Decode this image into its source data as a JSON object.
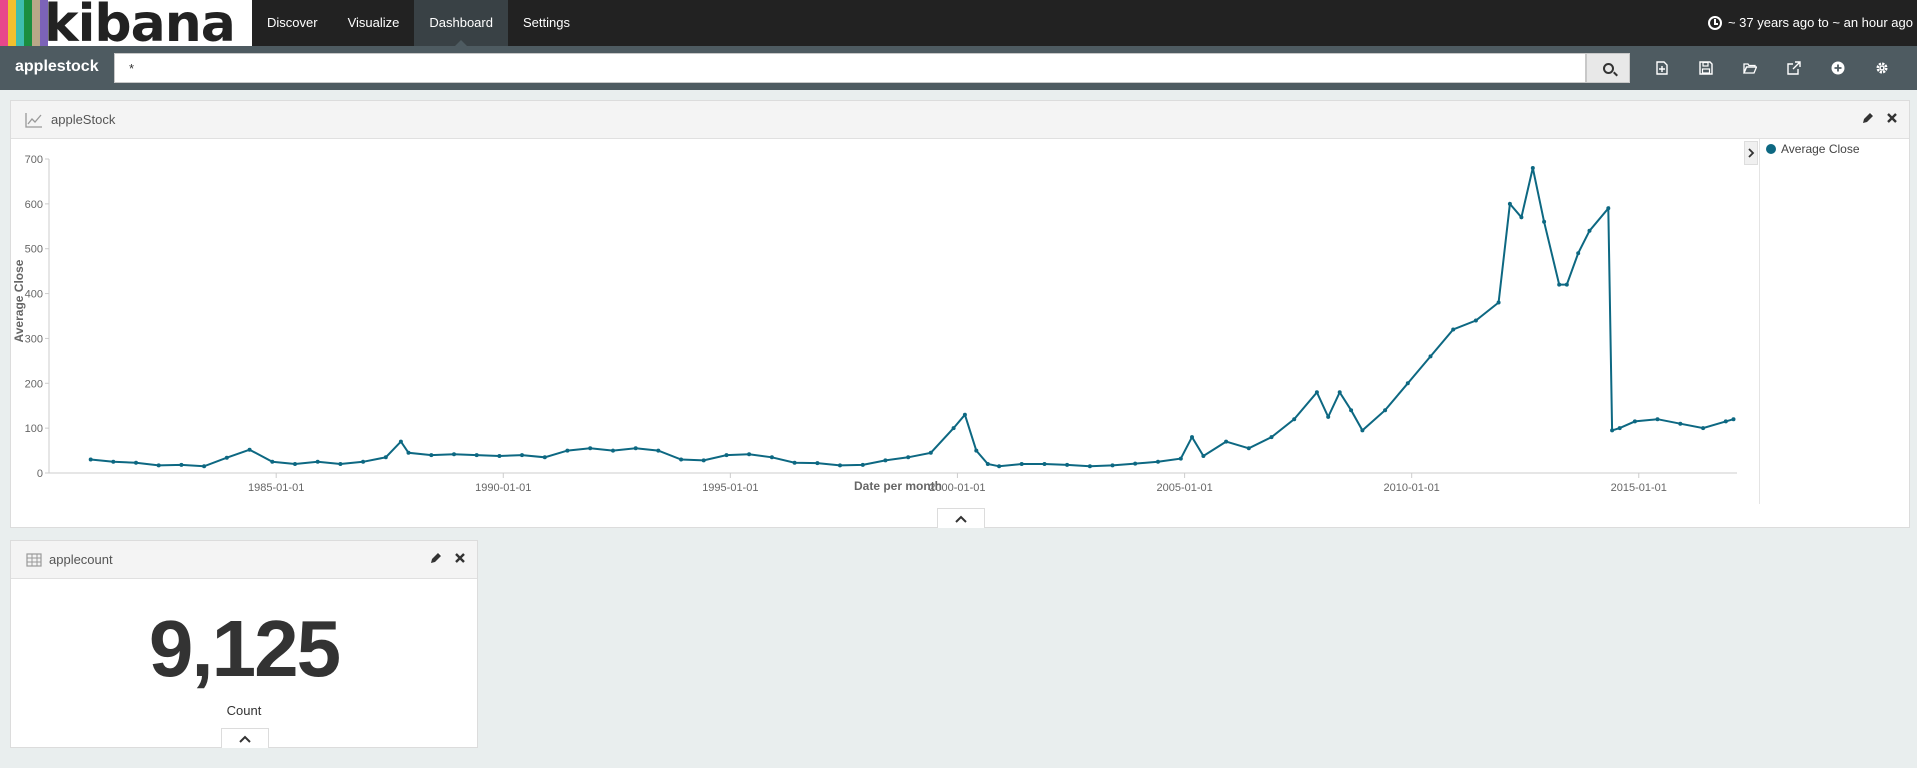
{
  "brand": {
    "logo_text": "kibana",
    "stripe_colors": [
      "#e8478b",
      "#f2c02e",
      "#3ebeb0",
      "#1b8e3f",
      "#b9a888",
      "#7c63b8"
    ]
  },
  "nav": {
    "links": [
      {
        "label": "Discover",
        "active": false
      },
      {
        "label": "Visualize",
        "active": false
      },
      {
        "label": "Dashboard",
        "active": true
      },
      {
        "label": "Settings",
        "active": false
      }
    ],
    "time_range": "~ 37 years ago to ~ an hour ago"
  },
  "querybar": {
    "dashboard_title": "applestock",
    "query": "*"
  },
  "colors": {
    "nav_bg": "#222222",
    "querybar_bg": "#4e5b61",
    "series": "#0d6882",
    "page_bg": "#e9eeee"
  },
  "panels": {
    "line": {
      "title": "appleStock",
      "legend_item": "Average Close"
    },
    "metric": {
      "title": "applecount",
      "value": "9,125",
      "label": "Count"
    }
  },
  "chart_data": {
    "type": "line",
    "title": "appleStock",
    "xlabel": "Date per month",
    "ylabel": "Average Close",
    "ylim": [
      0,
      700
    ],
    "y_ticks": [
      0,
      100,
      200,
      300,
      400,
      500,
      600,
      700
    ],
    "x_ticks": [
      "1985-01-01",
      "1990-01-01",
      "1995-01-01",
      "2000-01-01",
      "2005-01-01",
      "2010-01-01",
      "2015-01-01"
    ],
    "legend": "right",
    "series": [
      {
        "name": "Average Close",
        "x": [
          "1980-12-01",
          "1981-06-01",
          "1981-12-01",
          "1982-06-01",
          "1982-12-01",
          "1983-06-01",
          "1983-12-01",
          "1984-06-01",
          "1984-12-01",
          "1985-06-01",
          "1985-12-01",
          "1986-06-01",
          "1986-12-01",
          "1987-06-01",
          "1987-10-01",
          "1987-12-01",
          "1988-06-01",
          "1988-12-01",
          "1989-06-01",
          "1989-12-01",
          "1990-06-01",
          "1990-12-01",
          "1991-06-01",
          "1991-12-01",
          "1992-06-01",
          "1992-12-01",
          "1993-06-01",
          "1993-12-01",
          "1994-06-01",
          "1994-12-01",
          "1995-06-01",
          "1995-12-01",
          "1996-06-01",
          "1996-12-01",
          "1997-06-01",
          "1997-12-01",
          "1998-06-01",
          "1998-12-01",
          "1999-06-01",
          "1999-12-01",
          "2000-03-01",
          "2000-06-01",
          "2000-09-01",
          "2000-12-01",
          "2001-06-01",
          "2001-12-01",
          "2002-06-01",
          "2002-12-01",
          "2003-06-01",
          "2003-12-01",
          "2004-06-01",
          "2004-12-01",
          "2005-03-01",
          "2005-06-01",
          "2005-12-01",
          "2006-06-01",
          "2006-12-01",
          "2007-06-01",
          "2007-12-01",
          "2008-03-01",
          "2008-06-01",
          "2008-09-01",
          "2008-12-01",
          "2009-06-01",
          "2009-12-01",
          "2010-06-01",
          "2010-12-01",
          "2011-06-01",
          "2011-12-01",
          "2012-03-01",
          "2012-06-01",
          "2012-09-01",
          "2012-12-01",
          "2013-04-01",
          "2013-06-01",
          "2013-09-01",
          "2013-12-01",
          "2014-05-01",
          "2014-06-01",
          "2014-08-01",
          "2014-12-01",
          "2015-06-01",
          "2015-12-01",
          "2016-06-01",
          "2016-12-01",
          "2017-02-01"
        ],
        "values": [
          30,
          25,
          23,
          17,
          18,
          15,
          34,
          52,
          25,
          20,
          25,
          20,
          25,
          35,
          70,
          45,
          40,
          42,
          40,
          38,
          40,
          35,
          50,
          55,
          50,
          55,
          50,
          30,
          28,
          40,
          42,
          35,
          23,
          22,
          17,
          18,
          28,
          35,
          45,
          100,
          130,
          50,
          20,
          15,
          20,
          20,
          18,
          15,
          17,
          21,
          25,
          32,
          80,
          38,
          70,
          55,
          80,
          120,
          180,
          125,
          180,
          140,
          95,
          140,
          200,
          260,
          320,
          340,
          380,
          600,
          570,
          680,
          560,
          420,
          420,
          490,
          540,
          590,
          95,
          100,
          115,
          120,
          110,
          100,
          115,
          120
        ]
      }
    ]
  }
}
